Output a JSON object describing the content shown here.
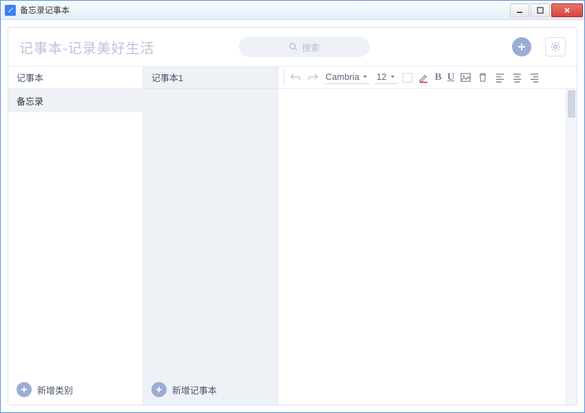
{
  "window": {
    "title": "备忘录记事本"
  },
  "header": {
    "app_title": "记事本-记录美好生活",
    "search_placeholder": "搜索"
  },
  "categories": {
    "header": "记事本",
    "items": [
      {
        "label": "备忘录"
      }
    ],
    "add_label": "新增类别"
  },
  "notes": {
    "header": "记事本1",
    "items": [],
    "add_label": "新增记事本"
  },
  "toolbar": {
    "font_name": "Cambria",
    "font_size": "12"
  }
}
